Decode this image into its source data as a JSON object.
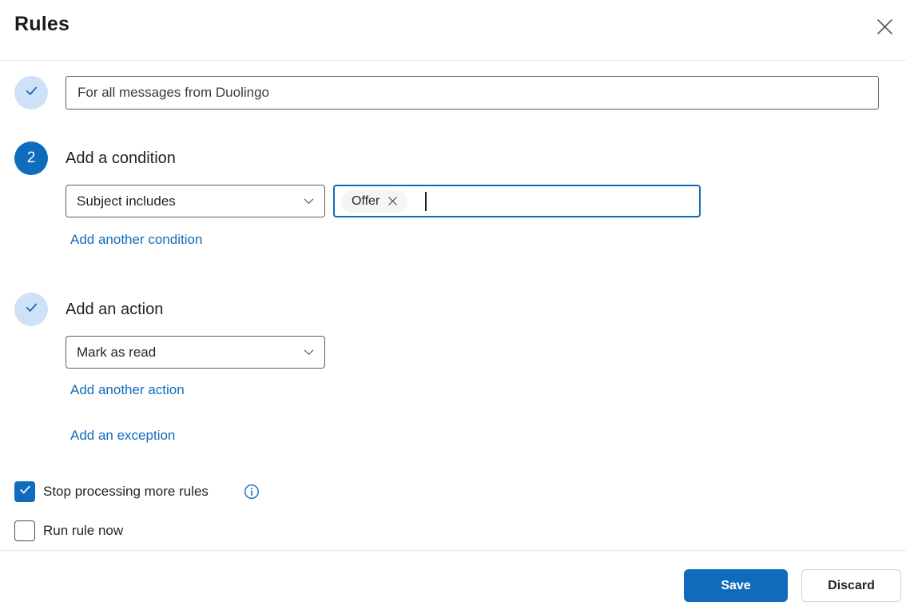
{
  "dialog": {
    "title": "Rules"
  },
  "rule_name": {
    "value": "For all messages from Duolingo",
    "step_state": "complete"
  },
  "condition_section": {
    "step_number": "2",
    "heading": "Add a condition",
    "condition_dropdown_value": "Subject includes",
    "chips": [
      "Offer"
    ],
    "add_link": "Add another condition"
  },
  "action_section": {
    "step_state": "complete",
    "heading": "Add an action",
    "action_dropdown_value": "Mark as read",
    "add_link": "Add another action",
    "exception_link": "Add an exception"
  },
  "options": {
    "stop_processing": {
      "label": "Stop processing more rules",
      "checked": true
    },
    "run_now": {
      "label": "Run rule now",
      "checked": false
    }
  },
  "footer": {
    "save_label": "Save",
    "discard_label": "Discard"
  },
  "icons": {
    "close": "close-icon",
    "check": "checkmark-icon",
    "chevron": "chevron-down-icon",
    "info": "info-icon",
    "chip_dismiss": "dismiss-icon"
  },
  "colors": {
    "accent": "#0f6cbd",
    "accent_light": "#cee1f6",
    "link": "#0f6cbd",
    "input_border": "#605e5c",
    "divider": "#e8e8e8",
    "text_primary": "#242424",
    "text_secondary": "#3b3a39",
    "chip_background": "#f5f5f4"
  }
}
